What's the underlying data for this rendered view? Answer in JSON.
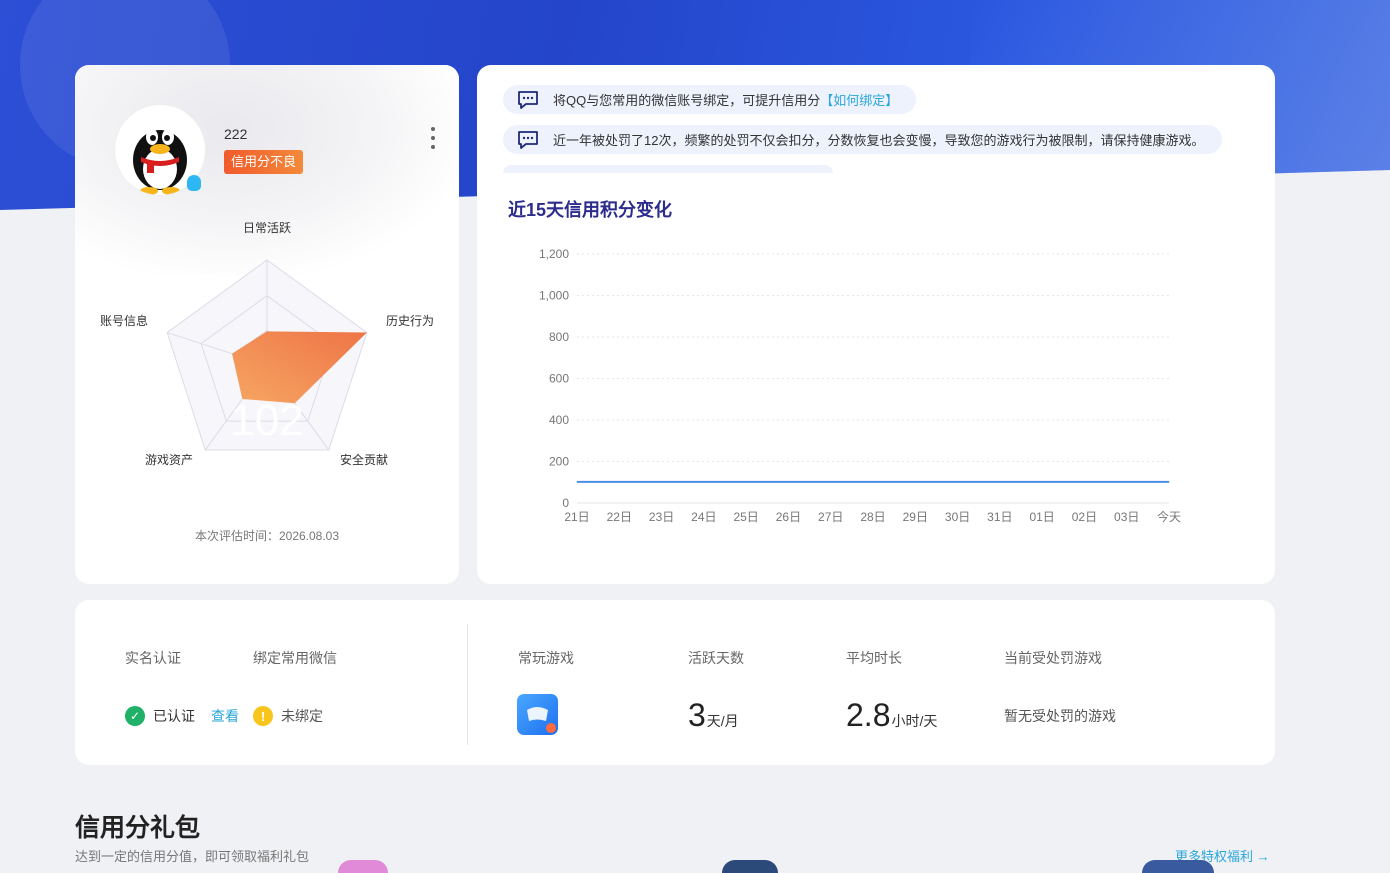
{
  "profile": {
    "username": "222",
    "credit_badge": "信用分不良",
    "radar_labels": {
      "daily": "日常活跃",
      "history": "历史行为",
      "security": "安全贡献",
      "assets": "游戏资产",
      "account": "账号信息"
    },
    "score": "102",
    "radar_values": {
      "daily": 0.32,
      "history": 1.0,
      "security": 0.45,
      "assets": 0.4,
      "account": 0.35
    },
    "eval_time": "本次评估时间：2026.08.03",
    "accent_orange": "#f08a4b"
  },
  "notices": [
    {
      "text": "将QQ与您常用的微信账号绑定，可提升信用分",
      "link": "【如何绑定】"
    },
    {
      "text": "近一年被处罚了12次，频繁的处罚不仅会扣分，分数恢复也会变慢，导致您的游戏行为被限制，请保持健康游戏。"
    }
  ],
  "chart": {
    "title": "近15天信用积分变化"
  },
  "chart_data": {
    "type": "line",
    "categories": [
      "21日",
      "22日",
      "23日",
      "24日",
      "25日",
      "26日",
      "27日",
      "28日",
      "29日",
      "30日",
      "31日",
      "01日",
      "02日",
      "03日",
      "今天"
    ],
    "series": [
      {
        "values": [
          102,
          102,
          102,
          102,
          102,
          102,
          102,
          102,
          102,
          102,
          102,
          102,
          102,
          102,
          102
        ]
      }
    ],
    "yticks": [
      "0",
      "200",
      "400",
      "600",
      "800",
      "1,000",
      "1,200"
    ],
    "ylim": [
      0,
      1200
    ],
    "grid": true,
    "line_color": "#4a8ee8"
  },
  "stats": {
    "realname_label": "实名认证",
    "wechat_label": "绑定常用微信",
    "realname_status": "已认证",
    "view_link": "查看",
    "wechat_status": "未绑定",
    "frequent_game_label": "常玩游戏",
    "active_days_label": "活跃天数",
    "active_days_value": "3",
    "active_days_unit": "天/月",
    "avg_duration_label": "平均时长",
    "avg_duration_value": "2.8",
    "avg_duration_unit": "小时/天",
    "penalty_label": "当前受处罚游戏",
    "penalty_value": "暂无受处罚的游戏"
  },
  "gifts": {
    "title": "信用分礼包",
    "subtitle": "达到一定的信用分值，即可领取福利礼包",
    "more_link": "更多特权福利 →"
  }
}
